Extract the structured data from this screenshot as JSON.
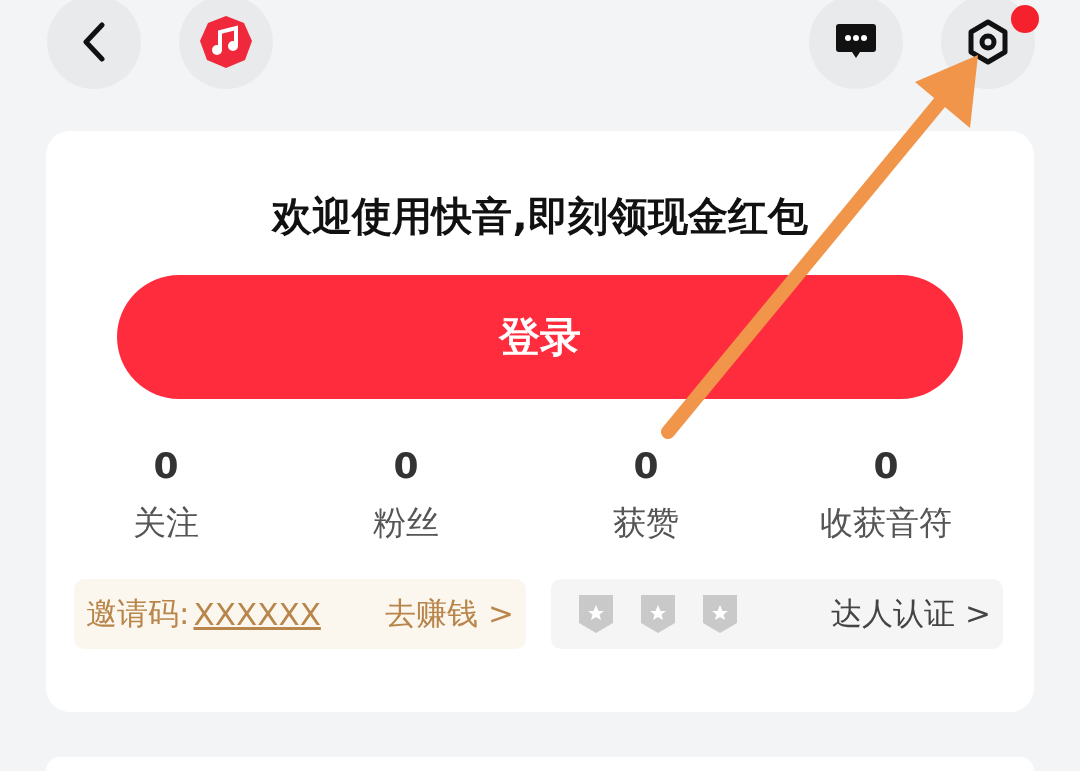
{
  "top_bar": {
    "settings_badge": true
  },
  "login_card": {
    "headline": "欢迎使用快音,即刻领现金红包",
    "login_button": "登录",
    "stats": [
      {
        "value": "0",
        "label": "关注"
      },
      {
        "value": "0",
        "label": "粉丝"
      },
      {
        "value": "0",
        "label": "获赞"
      },
      {
        "value": "0",
        "label": "收获音符"
      }
    ],
    "invite": {
      "label": "邀请码:",
      "code": "XXXXXX",
      "action": "去赚钱",
      "chevron": ">"
    },
    "certification": {
      "label": "达人认证",
      "chevron": ">"
    }
  }
}
